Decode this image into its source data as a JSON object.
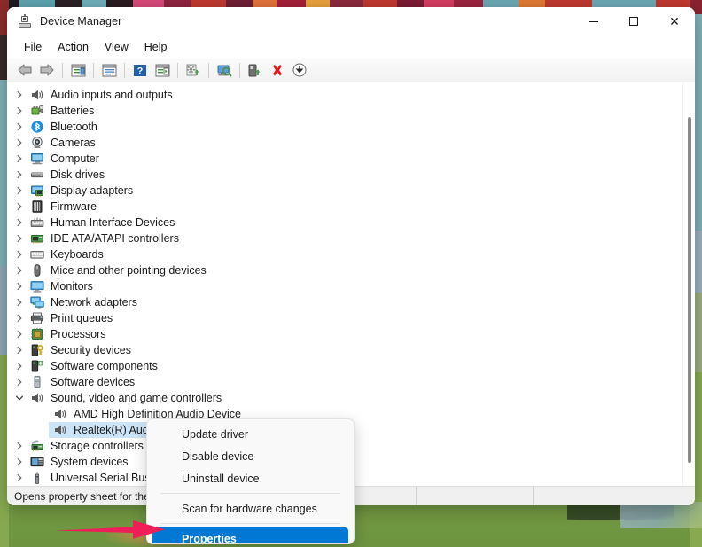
{
  "window": {
    "title": "Device Manager",
    "title_icon": "device-manager-icon",
    "controls": {
      "minimize": "—",
      "maximize": "☐",
      "close": "✕"
    }
  },
  "menubar": {
    "items": [
      {
        "label": "File"
      },
      {
        "label": "Action"
      },
      {
        "label": "View"
      },
      {
        "label": "Help"
      }
    ]
  },
  "toolbar": {
    "buttons": [
      {
        "name": "back-icon",
        "title": "Back"
      },
      {
        "name": "forward-icon",
        "title": "Forward"
      },
      {
        "name": "show-hide-console-tree-icon",
        "title": "Show/Hide Console Tree"
      },
      {
        "name": "properties-icon",
        "title": "Properties"
      },
      {
        "name": "help-icon",
        "title": "Help"
      },
      {
        "name": "show-hide-action-pane-icon",
        "title": "Show/Hide Action Pane"
      },
      {
        "name": "update-driver-icon",
        "title": "Update driver"
      },
      {
        "name": "scan-for-hardware-changes-icon",
        "title": "Scan for hardware changes"
      },
      {
        "name": "disable-device-icon",
        "title": "Disable device"
      },
      {
        "name": "uninstall-device-icon",
        "title": "Uninstall device"
      },
      {
        "name": "install-legacy-hardware-icon",
        "title": "Add drivers"
      }
    ]
  },
  "tree": {
    "nodes": [
      {
        "label": "Audio inputs and outputs",
        "icon": "speaker-icon",
        "state": "collapsed",
        "level": 1
      },
      {
        "label": "Batteries",
        "icon": "battery-icon",
        "state": "collapsed",
        "level": 1
      },
      {
        "label": "Bluetooth",
        "icon": "bluetooth-icon",
        "state": "collapsed",
        "level": 1
      },
      {
        "label": "Cameras",
        "icon": "camera-icon",
        "state": "collapsed",
        "level": 1
      },
      {
        "label": "Computer",
        "icon": "computer-icon",
        "state": "collapsed",
        "level": 1
      },
      {
        "label": "Disk drives",
        "icon": "disk-drive-icon",
        "state": "collapsed",
        "level": 1
      },
      {
        "label": "Display adapters",
        "icon": "display-adapter-icon",
        "state": "collapsed",
        "level": 1
      },
      {
        "label": "Firmware",
        "icon": "firmware-icon",
        "state": "collapsed",
        "level": 1
      },
      {
        "label": "Human Interface Devices",
        "icon": "hid-icon",
        "state": "collapsed",
        "level": 1
      },
      {
        "label": "IDE ATA/ATAPI controllers",
        "icon": "ide-controller-icon",
        "state": "collapsed",
        "level": 1
      },
      {
        "label": "Keyboards",
        "icon": "keyboard-icon",
        "state": "collapsed",
        "level": 1
      },
      {
        "label": "Mice and other pointing devices",
        "icon": "mouse-icon",
        "state": "collapsed",
        "level": 1
      },
      {
        "label": "Monitors",
        "icon": "monitor-icon",
        "state": "collapsed",
        "level": 1
      },
      {
        "label": "Network adapters",
        "icon": "network-adapter-icon",
        "state": "collapsed",
        "level": 1
      },
      {
        "label": "Print queues",
        "icon": "printer-icon",
        "state": "collapsed",
        "level": 1
      },
      {
        "label": "Processors",
        "icon": "processor-icon",
        "state": "collapsed",
        "level": 1
      },
      {
        "label": "Security devices",
        "icon": "security-device-icon",
        "state": "collapsed",
        "level": 1
      },
      {
        "label": "Software components",
        "icon": "software-component-icon",
        "state": "collapsed",
        "level": 1
      },
      {
        "label": "Software devices",
        "icon": "software-device-icon",
        "state": "collapsed",
        "level": 1
      },
      {
        "label": "Sound, video and game controllers",
        "icon": "speaker-icon",
        "state": "expanded",
        "level": 1
      },
      {
        "label": "AMD High Definition Audio Device",
        "icon": "speaker-icon",
        "state": "leaf",
        "level": 2
      },
      {
        "label": "Realtek(R) Audio",
        "icon": "speaker-icon",
        "state": "leaf",
        "level": 2,
        "selected": true
      },
      {
        "label": "Storage controllers",
        "icon": "storage-controller-icon",
        "state": "collapsed",
        "level": 1
      },
      {
        "label": "System devices",
        "icon": "system-device-icon",
        "state": "collapsed",
        "level": 1
      },
      {
        "label": "Universal Serial Bus controllers",
        "icon": "usb-icon",
        "state": "collapsed",
        "level": 1
      }
    ]
  },
  "context_menu": {
    "items": [
      {
        "label": "Update driver",
        "type": "item",
        "highlighted": false
      },
      {
        "label": "Disable device",
        "type": "item",
        "highlighted": false
      },
      {
        "label": "Uninstall device",
        "type": "item",
        "highlighted": false
      },
      {
        "type": "separator"
      },
      {
        "label": "Scan for hardware changes",
        "type": "item",
        "highlighted": false
      },
      {
        "type": "separator"
      },
      {
        "label": "Properties",
        "type": "item",
        "highlighted": true
      }
    ]
  },
  "statusbar": {
    "text": "Opens property sheet for the"
  },
  "annotation": {
    "arrow": {
      "color": "#ef1d58",
      "points_to": "Properties"
    }
  },
  "colors": {
    "accent": "#0078d4",
    "selection_soft": "#cce4f7",
    "arrow": "#ef1d58",
    "window_bg": "#ffffff",
    "statusbar_bg": "#f0f0f0"
  }
}
